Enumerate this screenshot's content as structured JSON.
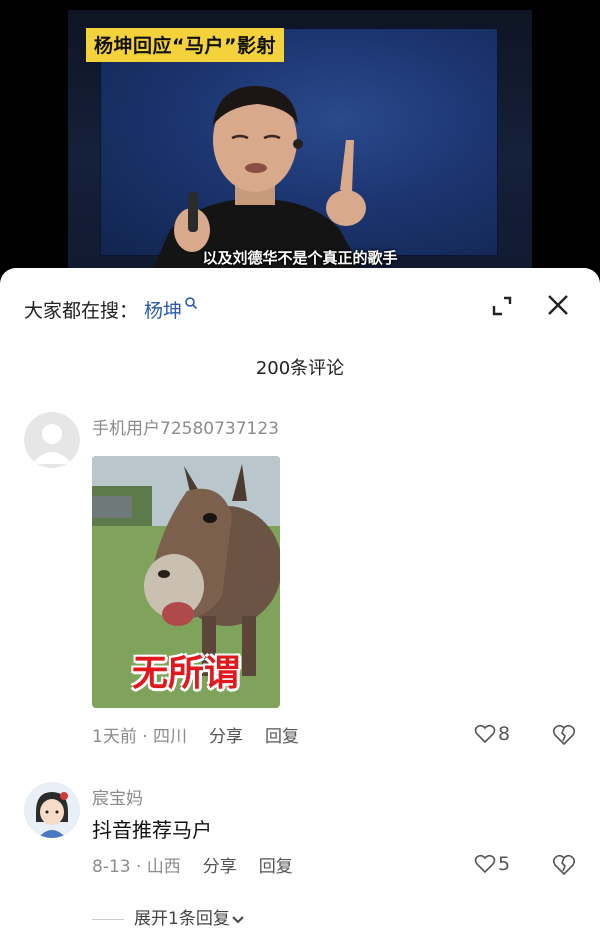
{
  "video": {
    "title": "杨坤回应“马户”影射",
    "subtitle": "以及刘德华不是个真正的歌手"
  },
  "sheet": {
    "search_prefix": "大家都在搜：",
    "search_term": "杨坤",
    "comments_count": "200条评论"
  },
  "comments": [
    {
      "username": "手机用户72580737123",
      "meme_caption": "无所谓",
      "time_location": "1天前 · 四川",
      "share": "分享",
      "reply": "回复",
      "likes": "8"
    },
    {
      "username": "宸宝妈",
      "text": "抖音推荐马户",
      "time_location": "8-13 · 山西",
      "share": "分享",
      "reply": "回复",
      "likes": "5"
    }
  ],
  "expand_replies": "展开1条回复",
  "colors": {
    "title_bg": "#f4d23c",
    "search_term": "#2a5aa8",
    "meme_caption": "#e0191e"
  },
  "icons": [
    "search-icon",
    "expand-icon",
    "close-icon",
    "heart-icon",
    "broken-heart-icon",
    "chevron-down-icon"
  ]
}
